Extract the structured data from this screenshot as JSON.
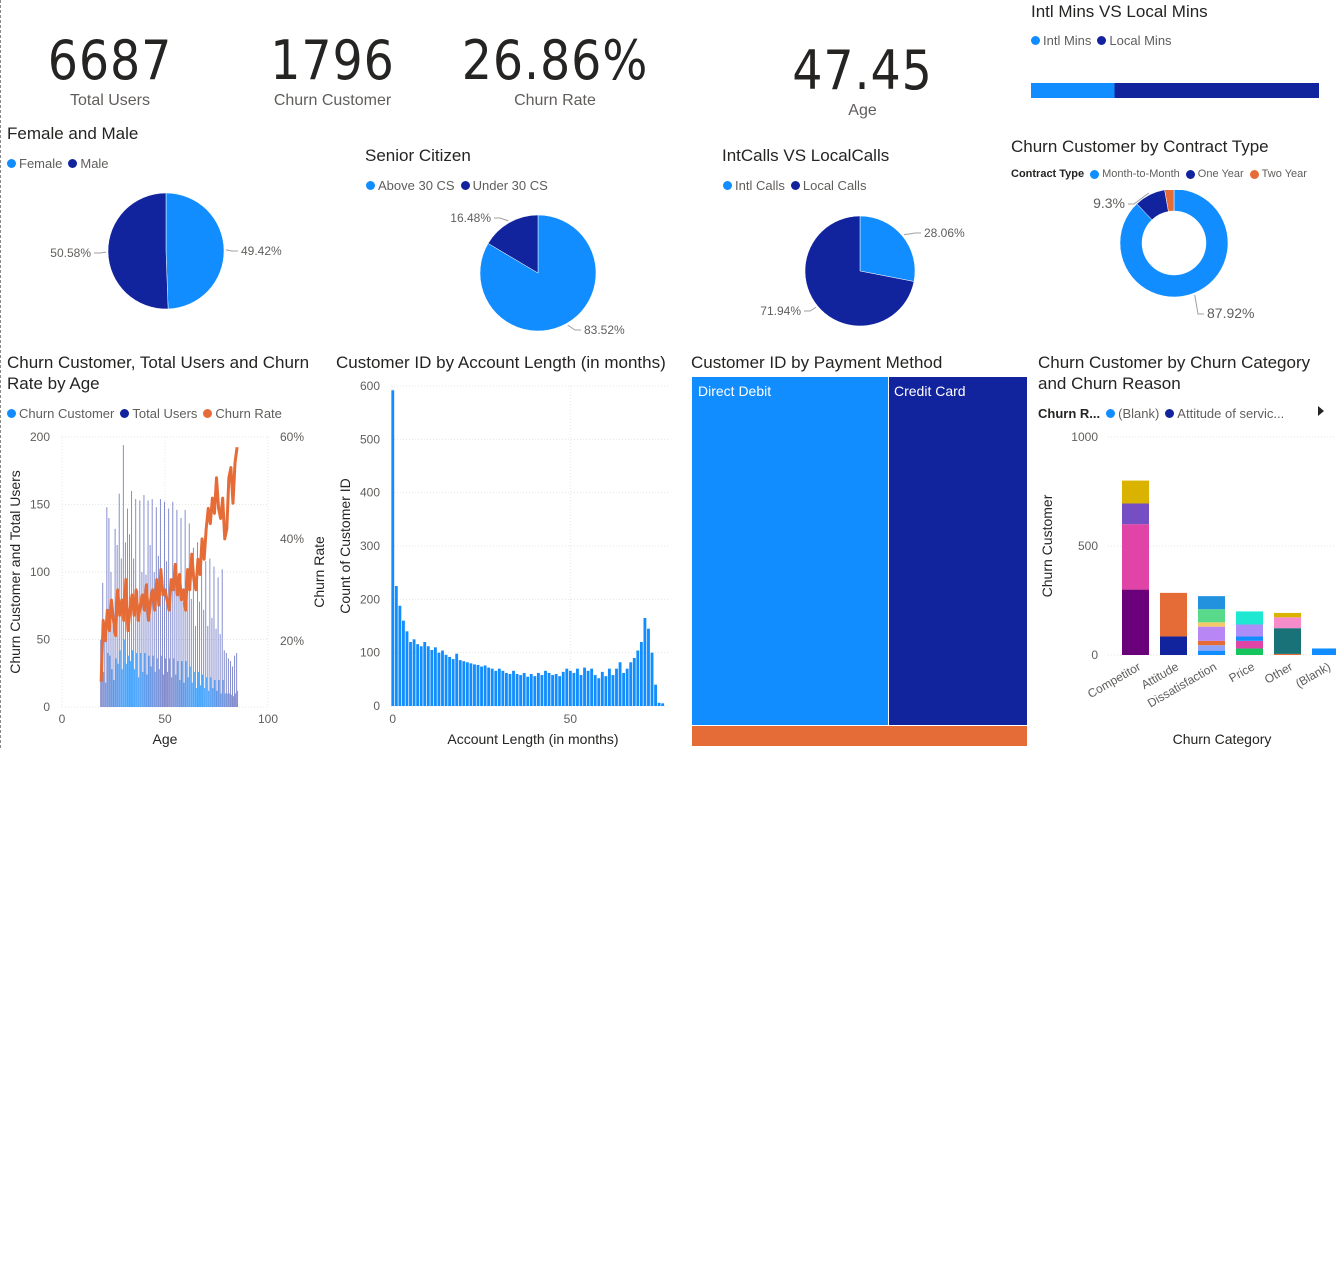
{
  "cards": [
    {
      "value": "6687",
      "label": "Total Users"
    },
    {
      "value": "1796",
      "label": "Churn Customer"
    },
    {
      "value": "26.86%",
      "label": "Churn Rate"
    },
    {
      "value": "47.45",
      "label": "Age"
    }
  ],
  "colors": {
    "light": "#118DFF",
    "dark": "#12239E",
    "orange": "#E66C37"
  },
  "legend_titles": {
    "contract": "Contract Type",
    "churn_reason": "Churn R..."
  },
  "chart_data": [
    {
      "type": "bar",
      "id": "intl_vs_local_mins",
      "title": "Intl Mins VS Local Mins",
      "series": [
        {
          "name": "Intl Mins",
          "values": [
            0.29
          ],
          "color": "#118DFF"
        },
        {
          "name": "Local Mins",
          "values": [
            0.71
          ],
          "color": "#12239E"
        }
      ]
    },
    {
      "type": "pie",
      "id": "gender",
      "title": "Female and Male",
      "labels": [
        "Female",
        "Male"
      ],
      "values": [
        49.42,
        50.58
      ],
      "value_labels": [
        "49.42%",
        "50.58%"
      ],
      "colors": [
        "#118DFF",
        "#12239E"
      ]
    },
    {
      "type": "pie",
      "id": "senior",
      "title": "Senior Citizen",
      "labels": [
        "Above 30 CS",
        "Under 30 CS"
      ],
      "values": [
        83.52,
        16.48
      ],
      "value_labels": [
        "83.52%",
        "16.48%"
      ],
      "colors": [
        "#118DFF",
        "#12239E"
      ]
    },
    {
      "type": "pie",
      "id": "calls",
      "title": "IntCalls VS LocalCalls",
      "labels": [
        "Intl Calls",
        "Local Calls"
      ],
      "values": [
        28.06,
        71.94
      ],
      "value_labels": [
        "28.06%",
        "71.94%"
      ],
      "colors": [
        "#118DFF",
        "#12239E"
      ]
    },
    {
      "type": "pie",
      "id": "contract",
      "title": "Churn Customer by Contract Type",
      "labels": [
        "Month-to-Month",
        "One Year",
        "Two Year"
      ],
      "values": [
        87.92,
        9.3,
        2.78
      ],
      "value_labels": [
        "87.92%",
        "9.3%",
        ""
      ],
      "colors": [
        "#118DFF",
        "#12239E",
        "#E66C37"
      ],
      "donut": true
    },
    {
      "type": "bar",
      "id": "age_combo",
      "title": "Churn Customer, Total Users and Churn Rate by Age",
      "xlabel": "Age",
      "ylabel": "Churn Customer and Total Users",
      "y2label": "Churn Rate",
      "xlim": [
        0,
        100
      ],
      "ylim": [
        0,
        200
      ],
      "y2lim": [
        0.07,
        0.6
      ],
      "x_ticks": [
        "0",
        "50",
        "100"
      ],
      "y_ticks": [
        "0",
        "50",
        "100",
        "150",
        "200"
      ],
      "y2_ticks": [
        "20%",
        "40%",
        "60%"
      ],
      "series": [
        {
          "name": "Churn Customer",
          "color": "#118DFF"
        },
        {
          "name": "Total Users",
          "color": "#12239E"
        },
        {
          "name": "Churn Rate",
          "color": "#E66C37"
        }
      ],
      "ages": [
        19,
        20,
        21,
        22,
        23,
        24,
        25,
        26,
        27,
        28,
        29,
        30,
        31,
        32,
        33,
        34,
        35,
        36,
        37,
        38,
        39,
        40,
        41,
        42,
        43,
        44,
        45,
        46,
        47,
        48,
        49,
        50,
        51,
        52,
        53,
        54,
        55,
        56,
        57,
        58,
        59,
        60,
        61,
        62,
        63,
        64,
        65,
        66,
        67,
        68,
        69,
        70,
        71,
        72,
        73,
        74,
        75,
        76,
        77,
        78,
        79,
        80,
        81,
        82,
        83,
        84,
        85
      ],
      "total_users": [
        50,
        92,
        60,
        148,
        140,
        100,
        75,
        132,
        120,
        158,
        110,
        194,
        122,
        147,
        128,
        160,
        110,
        154,
        86,
        153,
        100,
        157,
        98,
        153,
        120,
        154,
        100,
        148,
        112,
        154,
        94,
        152,
        108,
        147,
        88,
        152,
        100,
        146,
        86,
        140,
        78,
        146,
        96,
        136,
        80,
        118,
        60,
        122,
        78,
        120,
        72,
        108,
        60,
        110,
        66,
        104,
        58,
        96,
        54,
        102,
        42,
        40,
        36,
        34,
        30,
        38,
        40
      ],
      "churn_customer": [
        20,
        26,
        18,
        40,
        38,
        28,
        20,
        36,
        32,
        42,
        28,
        50,
        32,
        38,
        34,
        42,
        28,
        40,
        22,
        40,
        26,
        40,
        24,
        38,
        30,
        38,
        26,
        36,
        28,
        38,
        24,
        36,
        26,
        36,
        22,
        36,
        24,
        34,
        20,
        34,
        18,
        34,
        22,
        30,
        18,
        26,
        14,
        26,
        16,
        24,
        14,
        22,
        12,
        22,
        14,
        20,
        12,
        20,
        10,
        20,
        10,
        10,
        10,
        9,
        8,
        10,
        12
      ],
      "churn_rate": [
        0.12,
        0.24,
        0.2,
        0.26,
        0.22,
        0.28,
        0.24,
        0.21,
        0.3,
        0.25,
        0.28,
        0.24,
        0.32,
        0.22,
        0.26,
        0.29,
        0.25,
        0.3,
        0.24,
        0.27,
        0.29,
        0.26,
        0.31,
        0.24,
        0.28,
        0.3,
        0.26,
        0.32,
        0.27,
        0.34,
        0.29,
        0.3,
        0.28,
        0.26,
        0.32,
        0.3,
        0.35,
        0.29,
        0.33,
        0.28,
        0.3,
        0.26,
        0.34,
        0.3,
        0.37,
        0.32,
        0.3,
        0.36,
        0.33,
        0.4,
        0.36,
        0.42,
        0.46,
        0.43,
        0.48,
        0.45,
        0.52,
        0.46,
        0.44,
        0.48,
        0.4,
        0.42,
        0.52,
        0.54,
        0.47,
        0.55,
        0.58
      ]
    },
    {
      "type": "bar",
      "id": "account_length",
      "title": "Customer ID by Account Length (in months)",
      "xlabel": "Account Length (in months)",
      "ylabel": "Count of Customer ID",
      "xlim": [
        -0.5,
        77.5
      ],
      "ylim": [
        0,
        600
      ],
      "x_ticks": [
        "0",
        "50"
      ],
      "y_ticks": [
        "0",
        "100",
        "200",
        "300",
        "400",
        "500",
        "600"
      ],
      "x": [
        1,
        2,
        3,
        4,
        5,
        6,
        7,
        8,
        9,
        10,
        11,
        12,
        13,
        14,
        15,
        16,
        17,
        18,
        19,
        20,
        21,
        22,
        23,
        24,
        25,
        26,
        27,
        28,
        29,
        30,
        31,
        32,
        33,
        34,
        35,
        36,
        37,
        38,
        39,
        40,
        41,
        42,
        43,
        44,
        45,
        46,
        47,
        48,
        49,
        50,
        51,
        52,
        53,
        54,
        55,
        56,
        57,
        58,
        59,
        60,
        61,
        62,
        63,
        64,
        65,
        66,
        67,
        68,
        69,
        70,
        71,
        72,
        73,
        74,
        75,
        76,
        77
      ],
      "values": [
        592,
        225,
        188,
        160,
        140,
        120,
        125,
        116,
        112,
        120,
        112,
        105,
        110,
        100,
        104,
        96,
        92,
        88,
        98,
        86,
        84,
        82,
        80,
        78,
        77,
        74,
        76,
        72,
        70,
        66,
        70,
        66,
        62,
        60,
        66,
        60,
        58,
        62,
        55,
        60,
        56,
        62,
        58,
        66,
        62,
        58,
        60,
        56,
        64,
        70,
        66,
        62,
        70,
        58,
        72,
        66,
        70,
        58,
        52,
        64,
        56,
        70,
        58,
        70,
        82,
        62,
        70,
        82,
        90,
        104,
        120,
        165,
        145,
        100,
        40,
        6,
        5
      ],
      "color": "#118DFF"
    },
    {
      "type": "heatmap",
      "id": "payment_method",
      "title": "Customer ID by Payment Method",
      "labels": [
        "Direct Debit",
        "Credit Card",
        ""
      ],
      "values": [
        2700,
        1720,
        260
      ],
      "colors": [
        "#118DFF",
        "#12239E",
        "#E66C37"
      ]
    },
    {
      "type": "bar",
      "id": "churn_category",
      "title": "Churn Customer by Churn Category and Churn Reason",
      "xlabel": "Churn Category",
      "ylabel": "Churn Customer",
      "ylim": [
        0,
        1000
      ],
      "y_ticks": [
        "0",
        "500",
        "1000"
      ],
      "categories": [
        "Competitor",
        "Attitude",
        "Dissatisfaction",
        "Price",
        "Other",
        "(Blank)"
      ],
      "series": [
        {
          "name": "(Blank)",
          "color": "#118DFF",
          "values": [
            0,
            0,
            0,
            0,
            0,
            30
          ]
        },
        {
          "name": "Attitude of servic...",
          "color": "#12239E",
          "values": [
            0,
            85,
            0,
            0,
            0,
            0
          ]
        }
      ],
      "stacks": [
        [
          {
            "v": 300,
            "c": "#6B007B"
          },
          {
            "v": 300,
            "c": "#E044A7"
          },
          {
            "v": 95,
            "c": "#744EC2"
          },
          {
            "v": 105,
            "c": "#D9B300"
          }
        ],
        [
          {
            "v": 85,
            "c": "#12239E"
          },
          {
            "v": 200,
            "c": "#E66C37"
          }
        ],
        [
          {
            "v": 20,
            "c": "#118DFF"
          },
          {
            "v": 25,
            "c": "#91A4F5"
          },
          {
            "v": 20,
            "c": "#E66C37"
          },
          {
            "v": 65,
            "c": "#B887F5"
          },
          {
            "v": 20,
            "c": "#F5C869"
          },
          {
            "v": 60,
            "c": "#59D98A"
          },
          {
            "v": 60,
            "c": "#2292DF"
          }
        ],
        [
          {
            "v": 30,
            "c": "#15C55E"
          },
          {
            "v": 35,
            "c": "#E044A7"
          },
          {
            "v": 20,
            "c": "#118DFF"
          },
          {
            "v": 55,
            "c": "#AD8DF7"
          },
          {
            "v": 60,
            "c": "#1EE8D2"
          }
        ],
        [
          {
            "v": 5,
            "c": "#E66C37"
          },
          {
            "v": 118,
            "c": "#197278"
          },
          {
            "v": 50,
            "c": "#F68CC9"
          },
          {
            "v": 20,
            "c": "#D9B300"
          }
        ],
        [
          {
            "v": 30,
            "c": "#118DFF"
          }
        ]
      ]
    }
  ]
}
